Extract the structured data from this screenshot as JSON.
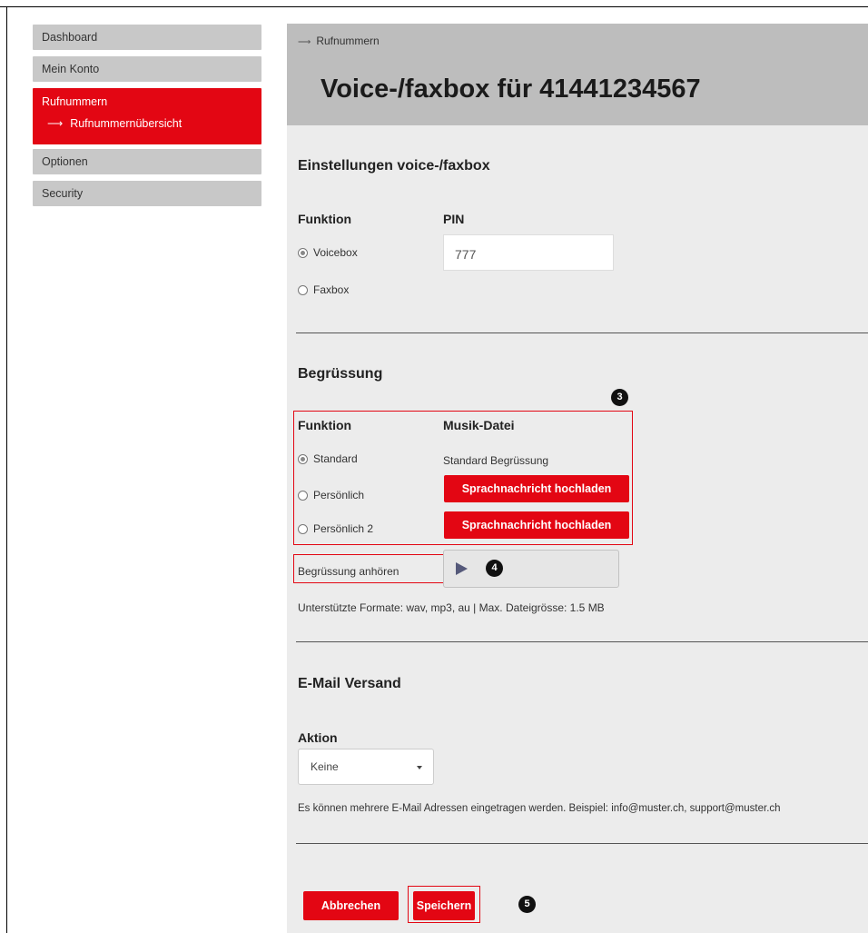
{
  "sidebar": {
    "items": [
      {
        "label": "Dashboard"
      },
      {
        "label": "Mein Konto"
      },
      {
        "label": "Rufnummern",
        "sub": "Rufnummernübersicht"
      },
      {
        "label": "Optionen"
      },
      {
        "label": "Security"
      }
    ]
  },
  "header": {
    "breadcrumb": "Rufnummern",
    "title": "Voice-/faxbox für 41441234567"
  },
  "settings": {
    "heading": "Einstellungen voice-/faxbox",
    "funktion_label": "Funktion",
    "pin_label": "PIN",
    "pin_value": "777",
    "options": [
      "Voicebox",
      "Faxbox"
    ],
    "selected": "Voicebox"
  },
  "greeting": {
    "heading": "Begrüssung",
    "funktion_label": "Funktion",
    "musik_label": "Musik-Datei",
    "options": [
      "Standard",
      "Persönlich",
      "Persönlich 2"
    ],
    "selected": "Standard",
    "standard_text": "Standard Begrüssung",
    "upload_button": "Sprachnachricht hochladen",
    "listen_label": "Begrüssung anhören",
    "formats_note": "Unterstützte Formate: wav, mp3, au | Max. Dateigrösse: 1.5 MB"
  },
  "email": {
    "heading": "E-Mail Versand",
    "aktion_label": "Aktion",
    "select_value": "Keine",
    "note": "Es können mehrere E-Mail Adressen eingetragen werden. Beispiel: info@muster.ch, support@muster.ch"
  },
  "actions": {
    "cancel": "Abbrechen",
    "save": "Speichern"
  },
  "annotations": {
    "badge3": "3",
    "badge4": "4",
    "badge5": "5"
  },
  "colors": {
    "accent": "#e30613",
    "sidebar": "#c8c8c8",
    "header": "#bdbdbd",
    "panel": "#ececec"
  }
}
